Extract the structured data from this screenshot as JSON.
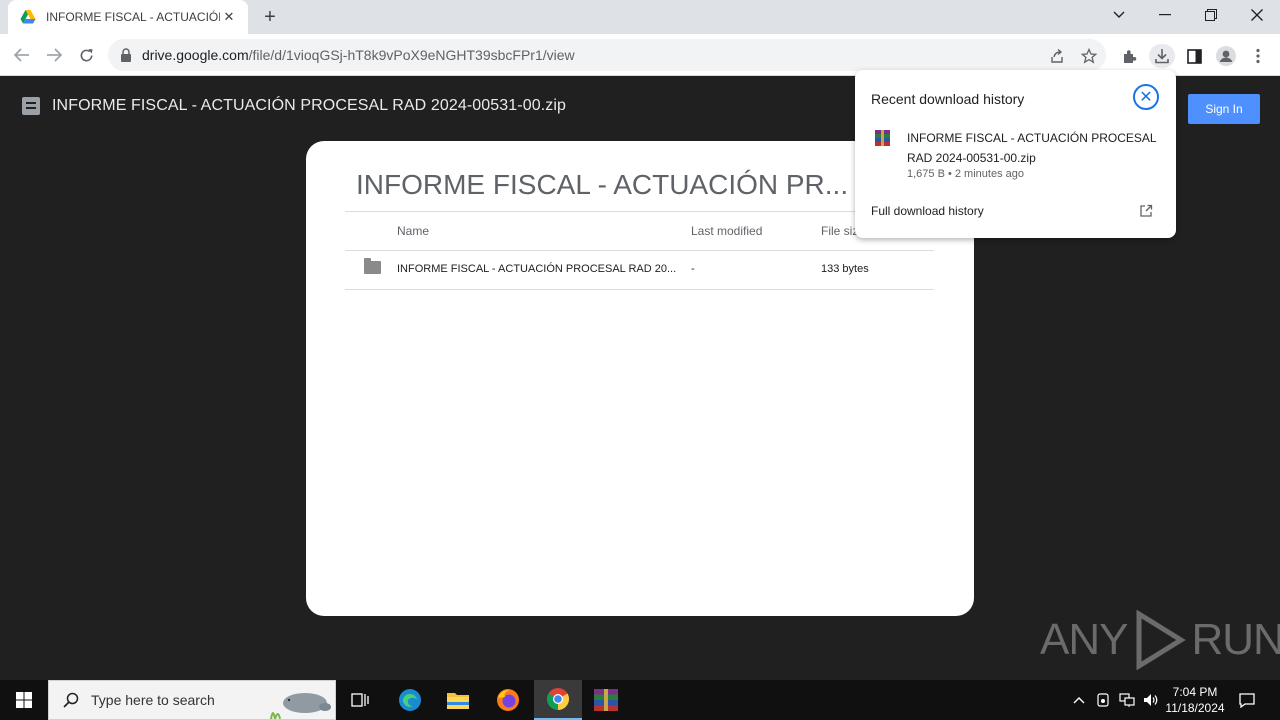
{
  "browser": {
    "tab": {
      "title": "INFORME FISCAL - ACTUACIÓN"
    },
    "url": {
      "host": "drive.google.com",
      "path": "/file/d/1vioqGSj-hT8k9vPoX9eNGHT39sbcFPr1/view"
    }
  },
  "viewer": {
    "title": "INFORME FISCAL - ACTUACIÓN PROCESAL RAD 2024-00531-00.zip",
    "sign_in_label": "Sign In"
  },
  "archive": {
    "title": "INFORME FISCAL - ACTUACIÓN PR...",
    "columns": {
      "name": "Name",
      "modified": "Last modified",
      "size": "File size"
    },
    "rows": [
      {
        "name": "INFORME FISCAL - ACTUACIÓN PROCESAL RAD 20...",
        "modified": "-",
        "size": "133 bytes"
      }
    ]
  },
  "download_bubble": {
    "heading": "Recent download history",
    "item": {
      "filename": "INFORME FISCAL - ACTUACIÓN PROCESAL RAD 2024-00531-00.zip",
      "meta": "1,675 B • 2 minutes ago"
    },
    "full_history_label": "Full download history"
  },
  "watermark": {
    "left": "ANY",
    "right": "RUN"
  },
  "taskbar": {
    "search_placeholder": "Type here to search",
    "clock": {
      "time": "7:04 PM",
      "date": "11/18/2024"
    }
  },
  "colors": {
    "accent": "#1a73e8",
    "signin": "#4d90fe",
    "viewer_bg": "#202020"
  }
}
